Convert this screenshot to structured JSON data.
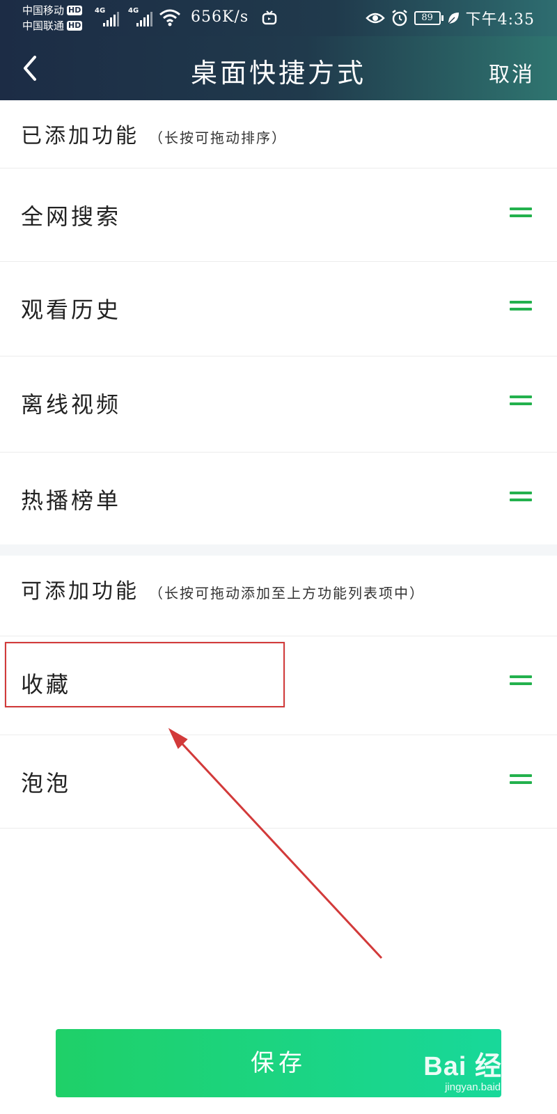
{
  "status_bar": {
    "carrier_1": "中国移动",
    "carrier_2": "中国联通",
    "hd_badge": "HD",
    "network_1": "4G",
    "network_2": "4G",
    "speed": "656K/s",
    "battery": "89",
    "time": "下午4:35",
    "icons": [
      "signal-icon",
      "wifi-icon",
      "tv-icon",
      "eye-icon",
      "alarm-icon",
      "battery-icon",
      "leaf-icon"
    ]
  },
  "nav": {
    "title": "桌面快捷方式",
    "cancel_label": "取消"
  },
  "added_section": {
    "title": "已添加功能",
    "hint": "（长按可拖动排序）",
    "items": [
      {
        "label": "全网搜索"
      },
      {
        "label": "观看历史"
      },
      {
        "label": "离线视频"
      },
      {
        "label": "热播榜单"
      }
    ]
  },
  "available_section": {
    "title": "可添加功能",
    "hint": "（长按可拖动添加至上方功能列表项中）",
    "items": [
      {
        "label": "收藏"
      },
      {
        "label": "泡泡"
      }
    ]
  },
  "save_label": "保存",
  "watermark": {
    "logo": "Bai 经验",
    "url": "jingyan.baidu.com"
  },
  "colors": {
    "accent_green": "#23b14d",
    "save_gradient_start": "#1fd068",
    "save_gradient_end": "#18d89a",
    "annotation_red": "#d23a3a",
    "nav_dark": "#1c2c45"
  }
}
